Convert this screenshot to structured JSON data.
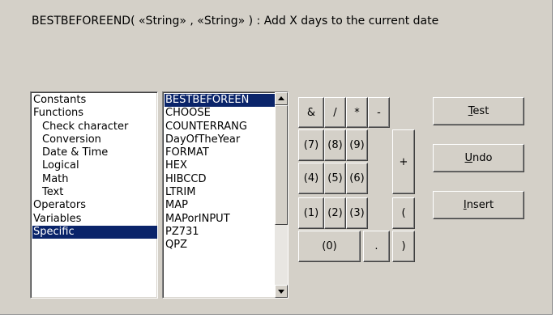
{
  "formula": {
    "text": "BESTBEFOREEND( «String» , «String» )   :   Add X days to the current date"
  },
  "categories": [
    {
      "label": "Constants",
      "indent": false,
      "selected": false
    },
    {
      "label": "Functions",
      "indent": false,
      "selected": false
    },
    {
      "label": "Check character",
      "indent": true,
      "selected": false
    },
    {
      "label": "Conversion",
      "indent": true,
      "selected": false
    },
    {
      "label": "Date & Time",
      "indent": true,
      "selected": false
    },
    {
      "label": "Logical",
      "indent": true,
      "selected": false
    },
    {
      "label": "Math",
      "indent": true,
      "selected": false
    },
    {
      "label": "Text",
      "indent": true,
      "selected": false
    },
    {
      "label": "Operators",
      "indent": false,
      "selected": false
    },
    {
      "label": "Variables",
      "indent": false,
      "selected": false
    },
    {
      "label": "Specific",
      "indent": false,
      "selected": true
    }
  ],
  "functions": [
    {
      "label": "BESTBEFOREEN",
      "selected": true
    },
    {
      "label": "CHOOSE",
      "selected": false
    },
    {
      "label": "COUNTERRANG",
      "selected": false
    },
    {
      "label": "DayOfTheYear",
      "selected": false
    },
    {
      "label": "FORMAT",
      "selected": false
    },
    {
      "label": "HEX",
      "selected": false
    },
    {
      "label": "HIBCCD",
      "selected": false
    },
    {
      "label": "LTRIM",
      "selected": false
    },
    {
      "label": "MAP",
      "selected": false
    },
    {
      "label": "MAPorINPUT",
      "selected": false
    },
    {
      "label": "PZ731",
      "selected": false
    },
    {
      "label": "QPZ",
      "selected": false
    }
  ],
  "keypad": {
    "amp": "&",
    "slash": "/",
    "star": "*",
    "minus": "-",
    "k7": "(7)",
    "k8": "(8)",
    "k9": "(9)",
    "plus": "+",
    "k4": "(4)",
    "k5": "(5)",
    "k6": "(6)",
    "k1": "(1)",
    "k2": "(2)",
    "k3": "(3)",
    "lparen": "(",
    "k0": "(0)",
    "dot": ".",
    "rparen": ")"
  },
  "actions": {
    "test": {
      "accel": "T",
      "rest": "est"
    },
    "undo": {
      "accel": "U",
      "rest": "ndo"
    },
    "insert": {
      "accel": "I",
      "rest": "nsert"
    }
  },
  "colors": {
    "panel": "#d4d0c8",
    "selection": "#0a246a"
  },
  "icons": {
    "scroll_up": "triangle-up-icon",
    "scroll_down": "triangle-down-icon"
  }
}
